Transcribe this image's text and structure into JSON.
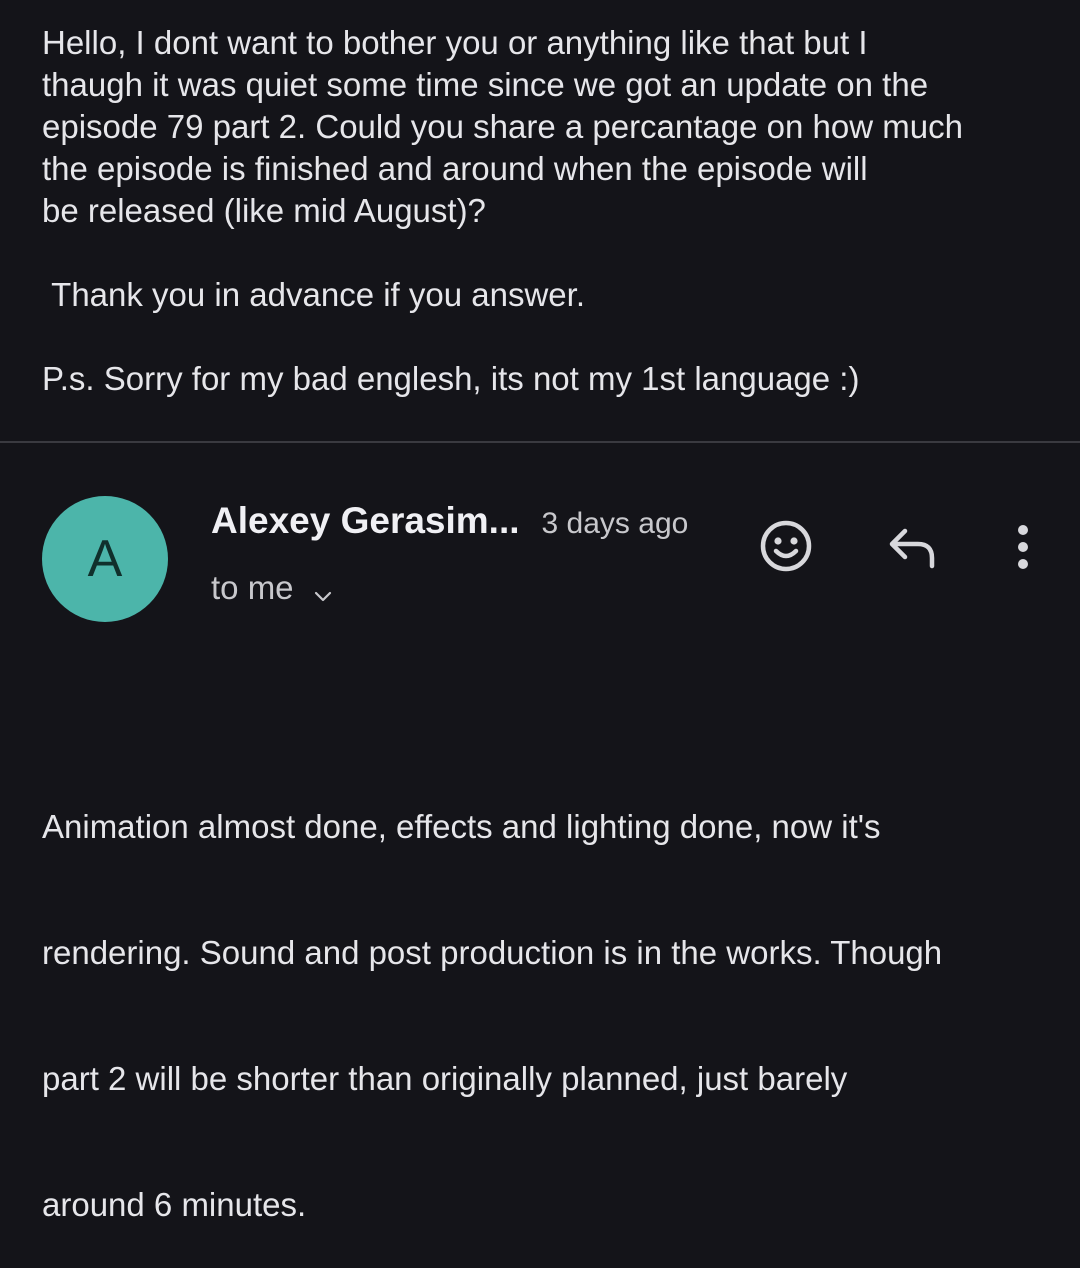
{
  "previous_message": {
    "body_lines": [
      "Hello, I dont want to bother you or anything like that but I",
      "thaugh it was quiet some time since we got an update on the",
      "episode 79 part 2. Could you share a percantage on how much",
      "the episode is finished and around when the episode will",
      "be released (like mid August)?"
    ],
    "thanks": " Thank you in advance if you answer.",
    "ps": "P.s. Sorry for my bad englesh, its not my 1st language :)"
  },
  "email": {
    "avatar_letter": "A",
    "avatar_color": "#4cb5aa",
    "sender_name": "Alexey Gerasim...",
    "time": "3 days ago",
    "recipient": "to me",
    "actions": {
      "emoji_icon": "add-reaction-icon",
      "reply_icon": "reply-icon",
      "more_icon": "more-vert-icon"
    },
    "body_lines": [
      "Animation almost done, effects and lighting done, now it's",
      "rendering. Sound and post production is in the works. Though",
      "part 2 will be shorter than originally planned, just barely",
      "around 6 minutes."
    ]
  },
  "colors": {
    "background": "#141419",
    "text": "#e6e6ea",
    "secondary_text": "#c8c8cc",
    "divider": "#3a3a40"
  }
}
